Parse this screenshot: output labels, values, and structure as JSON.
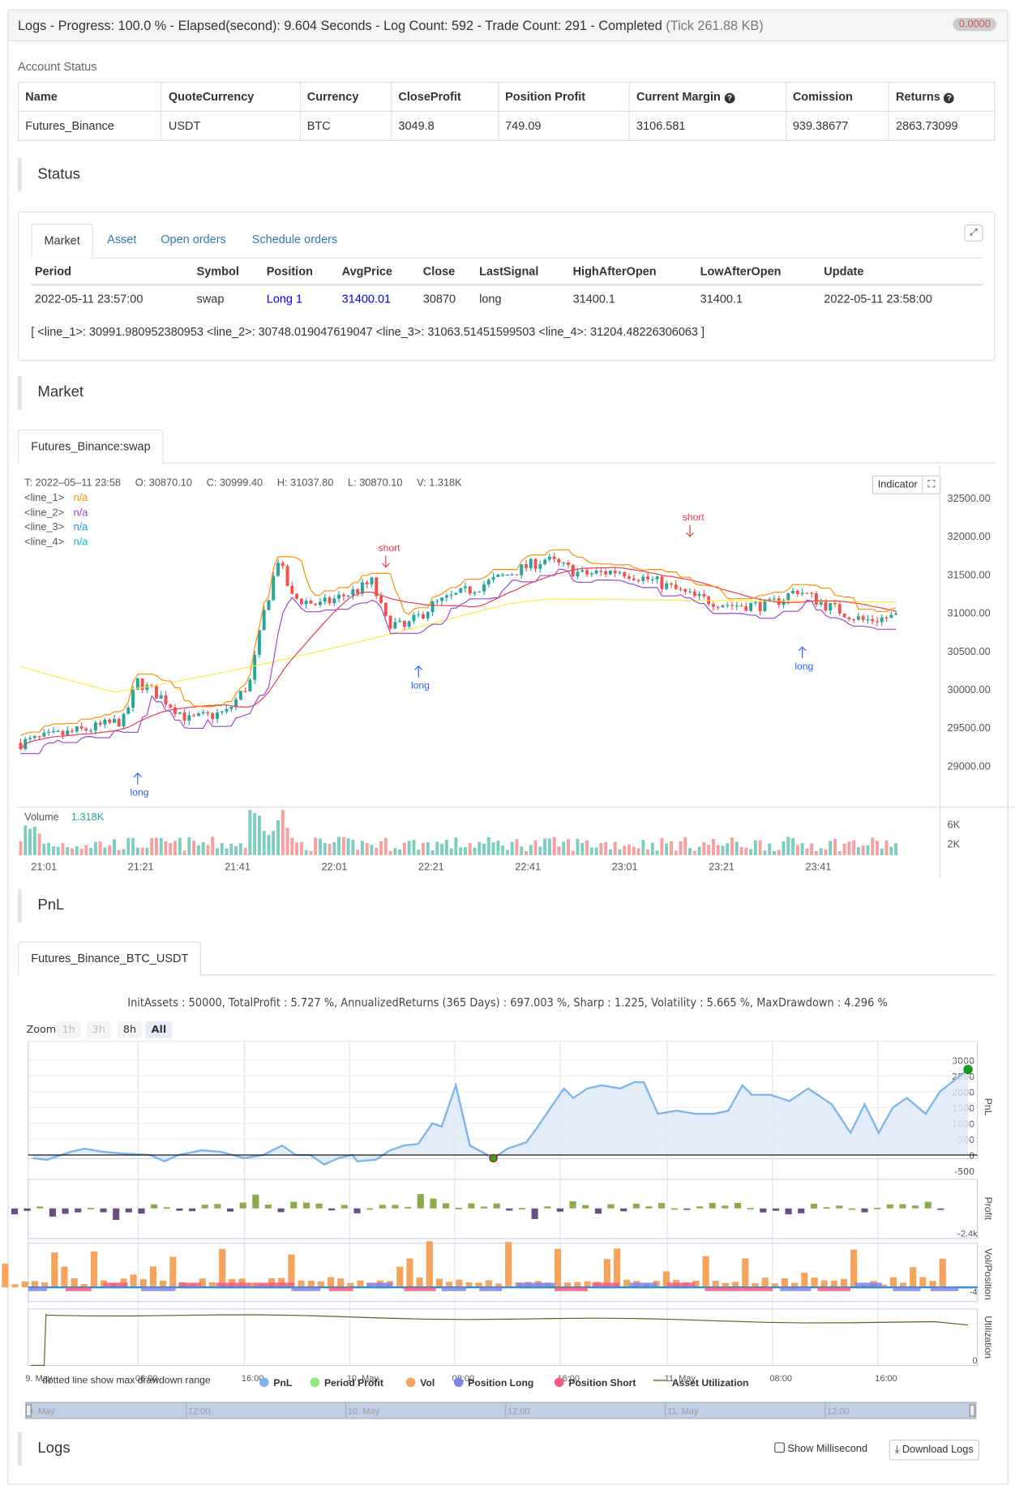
{
  "header": {
    "title": "Logs - Progress: 100.0 % - Elapsed(second): 9.604 Seconds - Log Count: 592 - Trade Count: 291 - Completed",
    "tick": "(Tick 261.88 KB)",
    "badge": "0.0000"
  },
  "account": {
    "label": "Account Status",
    "columns": [
      "Name",
      "QuoteCurrency",
      "Currency",
      "CloseProfit",
      "Position Profit",
      "Current Margin",
      "Comission",
      "Returns"
    ],
    "row": [
      "Futures_Binance",
      "USDT",
      "BTC",
      "3049.8",
      "749.09",
      "3106.581",
      "939.38677",
      "2863.73099"
    ]
  },
  "status": {
    "title": "Status",
    "tabs": [
      "Market",
      "Asset",
      "Open orders",
      "Schedule orders"
    ],
    "columns": [
      "Period",
      "Symbol",
      "Position",
      "AvgPrice",
      "Close",
      "LastSignal",
      "HighAfterOpen",
      "LowAfterOpen",
      "Update"
    ],
    "row": [
      "2022-05-11 23:57:00",
      "swap",
      "Long 1",
      "31400.01",
      "30870",
      "long",
      "31400.1",
      "31400.1",
      "2022-05-11 23:58:00"
    ],
    "lines": "[ <line_1>: 30991.980952380953 <line_2>: 30748.019047619047 <line_3>: 31063.51451599503 <line_4>: 31204.48226306063 ]"
  },
  "market": {
    "title": "Market",
    "tab": "Futures_Binance:swap",
    "ohlc": "T: 2022–05–11 23:58     O: 30870.10     C: 30999.40     H: 31037.80     L: 30870.10     V: 1.318K",
    "legend": [
      {
        "name": "<line_1>",
        "value": "n/a",
        "color": "#ff8c00"
      },
      {
        "name": "<line_2>",
        "value": "n/a",
        "color": "#9c42d6"
      },
      {
        "name": "<line_3>",
        "value": "n/a",
        "color": "#2196f3"
      },
      {
        "name": "<line_4>",
        "value": "n/a",
        "color": "#00bcd4"
      }
    ],
    "indicator": "Indicator",
    "price_ticks": [
      "32500.00",
      "32000.00",
      "31500.00",
      "31000.00",
      "30500.00",
      "30000.00",
      "29500.00",
      "29000.00"
    ],
    "volume_label": "Volume",
    "volume_value": "1.318K",
    "volume_ticks": [
      "6K",
      "2K"
    ],
    "time_ticks": [
      "21:01",
      "21:21",
      "21:41",
      "22:01",
      "22:21",
      "22:41",
      "23:01",
      "23:21",
      "23:41"
    ],
    "price_path": [
      [
        0,
        29300
      ],
      [
        8,
        29400
      ],
      [
        16,
        29500
      ],
      [
        22,
        29600
      ],
      [
        25,
        30100
      ],
      [
        30,
        29900
      ],
      [
        36,
        29600
      ],
      [
        44,
        29700
      ],
      [
        49,
        30100
      ],
      [
        52,
        31000
      ],
      [
        55,
        31700
      ],
      [
        58,
        31200
      ],
      [
        64,
        31100
      ],
      [
        72,
        31300
      ],
      [
        75,
        31400
      ],
      [
        78,
        30900
      ],
      [
        82,
        30800
      ],
      [
        88,
        31100
      ],
      [
        96,
        31300
      ],
      [
        104,
        31500
      ],
      [
        112,
        31700
      ],
      [
        120,
        31500
      ],
      [
        128,
        31550
      ],
      [
        136,
        31400
      ],
      [
        144,
        31200
      ],
      [
        152,
        31100
      ],
      [
        160,
        31100
      ],
      [
        166,
        31300
      ],
      [
        172,
        31100
      ],
      [
        180,
        30900
      ],
      [
        187,
        30950
      ]
    ],
    "signals": [
      {
        "label": "short",
        "i": 78,
        "p": 31500
      },
      {
        "label": "short",
        "i": 143,
        "p": 31900
      },
      {
        "label": "long",
        "i": 25,
        "p": 29100
      },
      {
        "label": "long",
        "i": 85,
        "p": 30500
      },
      {
        "label": "long",
        "i": 167,
        "p": 30750
      }
    ]
  },
  "pnl": {
    "title": "PnL",
    "tab": "Futures_Binance_BTC_USDT",
    "stats": "InitAssets : 50000, TotalProfit : 5.727 %, AnnualizedReturns (365 Days) : 697.003 %, Sharp : 1.225, Volatility : 5.665 %, MaxDrawdown : 4.296 %",
    "zoom_label": "Zoom",
    "zoom_buttons": [
      "1h",
      "3h",
      "8h",
      "All"
    ],
    "pnl_ticks": [
      "3000",
      "2500",
      "2000",
      "1500",
      "1000",
      "500",
      "0",
      "-500"
    ],
    "axis_titles": [
      "PnL",
      "Profit",
      "Vol/Position",
      "Utilization"
    ],
    "profit_tick": "-2.4k",
    "vol_tick": "-4",
    "util_tick": "0",
    "time_ticks": [
      "9. May",
      "08:00",
      "16:00",
      "10. May",
      "08:00",
      "16:00",
      "11. May",
      "08:00",
      "16:00"
    ],
    "note": "dotted line show max drawdown range",
    "legend": [
      {
        "label": "PnL",
        "color": "#7cb5ec"
      },
      {
        "label": "Period Profit",
        "color": "#90ed7d"
      },
      {
        "label": "Vol",
        "color": "#f7a35c"
      },
      {
        "label": "Position Long",
        "color": "#8085e9"
      },
      {
        "label": "Position Short",
        "color": "#f15c80"
      },
      {
        "label": "Asset Utilization",
        "color": "#a09a70"
      }
    ],
    "navigator": [
      "9. May",
      "12:00",
      "10. May",
      "12:00",
      "11. May",
      "12:00"
    ],
    "series": [
      [
        0,
        -100
      ],
      [
        15,
        -150
      ],
      [
        40,
        100
      ],
      [
        55,
        200
      ],
      [
        75,
        100
      ],
      [
        95,
        50
      ],
      [
        125,
        0
      ],
      [
        140,
        -200
      ],
      [
        155,
        0
      ],
      [
        180,
        150
      ],
      [
        200,
        100
      ],
      [
        225,
        -100
      ],
      [
        245,
        0
      ],
      [
        265,
        300
      ],
      [
        280,
        0
      ],
      [
        295,
        0
      ],
      [
        310,
        -300
      ],
      [
        325,
        -100
      ],
      [
        340,
        0
      ],
      [
        345,
        -200
      ],
      [
        365,
        -150
      ],
      [
        380,
        150
      ],
      [
        395,
        300
      ],
      [
        410,
        350
      ],
      [
        425,
        1000
      ],
      [
        435,
        900
      ],
      [
        450,
        2200
      ],
      [
        465,
        300
      ],
      [
        490,
        -100
      ],
      [
        505,
        200
      ],
      [
        525,
        400
      ],
      [
        535,
        800
      ],
      [
        565,
        2100
      ],
      [
        575,
        1800
      ],
      [
        590,
        2100
      ],
      [
        605,
        2200
      ],
      [
        625,
        2100
      ],
      [
        640,
        2300
      ],
      [
        650,
        2300
      ],
      [
        665,
        1300
      ],
      [
        685,
        1400
      ],
      [
        705,
        1300
      ],
      [
        725,
        1300
      ],
      [
        740,
        1400
      ],
      [
        755,
        2200
      ],
      [
        765,
        1900
      ],
      [
        785,
        1900
      ],
      [
        805,
        1700
      ],
      [
        825,
        2100
      ],
      [
        850,
        1600
      ],
      [
        870,
        700
      ],
      [
        885,
        1600
      ],
      [
        900,
        700
      ],
      [
        915,
        1500
      ],
      [
        930,
        1800
      ],
      [
        950,
        1300
      ],
      [
        965,
        2000
      ],
      [
        995,
        2700
      ]
    ]
  },
  "logs": {
    "title": "Logs",
    "show_ms": "Show Millisecond",
    "download": "Download Logs"
  }
}
